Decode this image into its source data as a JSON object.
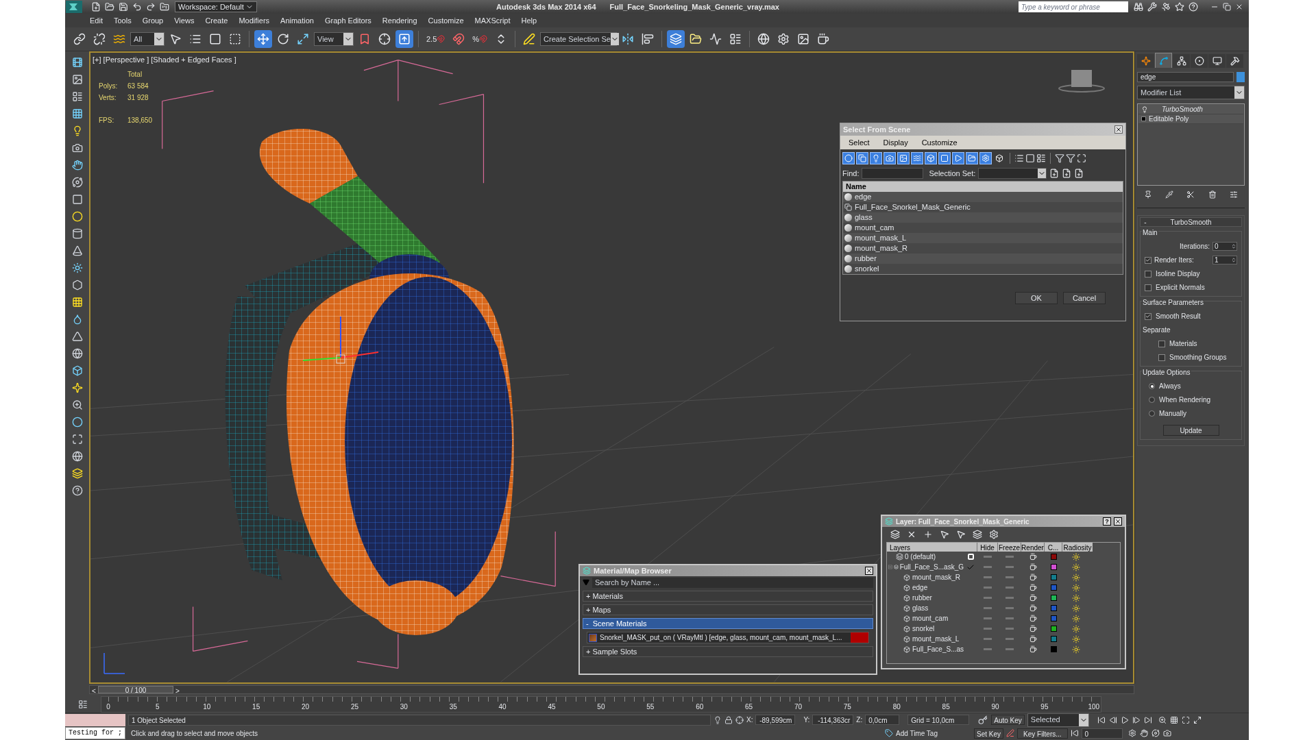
{
  "window": {
    "title": "Autodesk 3ds Max  2014 x64",
    "document": "Full_Face_Snorkeling_Mask_Generic_vray.max",
    "workspace": "Workspace: Default",
    "search": {
      "placeholder": "Type a keyword or phrase"
    }
  },
  "menu": [
    "Edit",
    "Tools",
    "Group",
    "Views",
    "Create",
    "Modifiers",
    "Animation",
    "Graph Editors",
    "Rendering",
    "Customize",
    "MAXScript",
    "Help"
  ],
  "toolbar": {
    "selection_filter": "All",
    "reference_coord": "View",
    "snap": "2.5",
    "percent_snap": "%",
    "named_selection": "Create Selection Se",
    "tools": [
      {
        "selected": false
      },
      {
        "selected": false
      },
      {
        "selected": false
      },
      {
        "selected": false
      },
      {
        "selected": false
      },
      {
        "selected": false
      },
      {
        "selected": false
      },
      {
        "selected": true
      },
      {
        "selected": false
      },
      {
        "selected": false
      },
      {
        "selected": false
      },
      {
        "selected": false
      },
      {
        "selected": true
      },
      {
        "selected": false
      },
      {
        "selected": false
      },
      {
        "selected": false
      },
      {
        "selected": false
      },
      {
        "selected": false
      },
      {
        "selected": true
      },
      {
        "selected": false
      },
      {
        "selected": false
      },
      {
        "selected": false
      },
      {
        "selected": false
      },
      {
        "selected": false
      },
      {
        "selected": false
      },
      {
        "selected": false
      }
    ]
  },
  "viewport": {
    "label": "[+] [Perspective ] [Shaded + Edged Faces ]",
    "stats": {
      "heading": "Total",
      "rows": [
        {
          "label": "Polys:",
          "value": "63 584"
        },
        {
          "label": "Verts:",
          "value": "31 928"
        }
      ],
      "fps_label": "FPS:",
      "fps": "138,650"
    }
  },
  "select_from_scene": {
    "title": "Select From Scene",
    "menu": [
      "Select",
      "Display",
      "Customize"
    ],
    "filters": [
      {
        "on": true
      },
      {
        "on": true
      },
      {
        "on": true
      },
      {
        "on": true
      },
      {
        "on": true
      },
      {
        "on": true
      },
      {
        "on": true
      },
      {
        "on": true
      },
      {
        "on": true
      },
      {
        "on": true
      },
      {
        "on": true
      },
      {
        "on": false
      }
    ],
    "find_label": "Find:",
    "selection_set_label": "Selection Set:",
    "column": "Name",
    "objects": [
      {
        "name": "edge",
        "kind": "object"
      },
      {
        "name": "Full_Face_Snorkel_Mask_Generic",
        "kind": "group"
      },
      {
        "name": "glass",
        "kind": "object"
      },
      {
        "name": "mount_cam",
        "kind": "object"
      },
      {
        "name": "mount_mask_L",
        "kind": "object"
      },
      {
        "name": "mount_mask_R",
        "kind": "object"
      },
      {
        "name": "rubber",
        "kind": "object"
      },
      {
        "name": "snorkel",
        "kind": "object"
      }
    ],
    "buttons": [
      "OK",
      "Cancel"
    ]
  },
  "command_panel": {
    "tabs": [
      {
        "selected": false
      },
      {
        "selected": true
      },
      {
        "selected": false
      },
      {
        "selected": false
      },
      {
        "selected": false
      },
      {
        "selected": false
      }
    ],
    "object_name": "edge",
    "modifier_list": "Modifier List",
    "stack": [
      {
        "name": "TurboSmooth",
        "kind": "modifier"
      },
      {
        "name": "Editable Poly",
        "kind": "base"
      }
    ],
    "rollout": {
      "sign": "-",
      "title": "TurboSmooth",
      "groups": [
        {
          "title": "Main",
          "controls": [
            {
              "kind": "spinner",
              "label": "Iterations:",
              "value": "0"
            },
            {
              "kind": "check_spinner",
              "label": "Render Iters:",
              "value": "1",
              "checked": true
            },
            {
              "kind": "check",
              "label": "Isoline Display",
              "checked": false
            },
            {
              "kind": "check",
              "label": "Explicit Normals",
              "checked": false
            }
          ]
        },
        {
          "title": "Surface Parameters",
          "controls": [
            {
              "kind": "check",
              "label": "Smooth Result",
              "checked": true
            },
            {
              "kind": "label",
              "label": "Separate"
            },
            {
              "kind": "subcheck",
              "label": "Materials",
              "checked": false
            },
            {
              "kind": "subcheck",
              "label": "Smoothing Groups",
              "checked": false
            }
          ]
        },
        {
          "title": "Update Options",
          "controls": [
            {
              "kind": "radio",
              "label": "Always",
              "selected": true
            },
            {
              "kind": "radio",
              "label": "When Rendering",
              "selected": false
            },
            {
              "kind": "radio",
              "label": "Manually",
              "selected": false
            },
            {
              "kind": "button",
              "label": "Update"
            }
          ]
        }
      ]
    }
  },
  "layer_dialog": {
    "title": "Layer: Full_Face_Snorkel_Mask_Generic",
    "help": "?",
    "columns": [
      "Layers",
      "Hide",
      "Freeze",
      "Render",
      "C...",
      "Radiosity"
    ],
    "layers": [
      {
        "name": "0 (default)",
        "current": false,
        "color": "#8a0a0a"
      },
      {
        "name": "Full_Face_S...ask_G",
        "current": true,
        "expanded": true,
        "color": "#d24fd2",
        "children": [
          {
            "name": "mount_mask_R",
            "color": "#147c8c"
          },
          {
            "name": "edge",
            "color": "#1f56c4"
          },
          {
            "name": "rubber",
            "color": "#1fb456"
          },
          {
            "name": "glass",
            "color": "#1f56c4"
          },
          {
            "name": "mount_cam",
            "color": "#1f56c4"
          },
          {
            "name": "snorkel",
            "color": "#20b020"
          },
          {
            "name": "mount_mask_L",
            "color": "#147c8c"
          },
          {
            "name": "Full_Face_S...as",
            "color": "#000000"
          }
        ]
      }
    ]
  },
  "material_browser": {
    "title": "Material/Map Browser",
    "search": {
      "placeholder": "Search by Name ..."
    },
    "groups": [
      {
        "sign": "+",
        "label": "Materials",
        "expanded": false
      },
      {
        "sign": "+",
        "label": "Maps",
        "expanded": false
      },
      {
        "sign": "-",
        "label": "Scene Materials",
        "expanded": true,
        "items": [
          "Snorkel_MASK_put_on  ( VRayMtl ) [edge, glass, mount_cam, mount_mask_L..."
        ]
      },
      {
        "sign": "+",
        "label": "Sample Slots",
        "expanded": false
      }
    ]
  },
  "timeline": {
    "prev": "<",
    "frame": "0 / 100",
    "next": ">",
    "ticks": [
      "0",
      "5",
      "10",
      "15",
      "20",
      "25",
      "30",
      "35",
      "40",
      "45",
      "50",
      "55",
      "60",
      "65",
      "70",
      "75",
      "80",
      "85",
      "90",
      "95",
      "100"
    ]
  },
  "status": {
    "listener": "Testing for ;",
    "selection": "1 Object Selected",
    "prompt": "Click and drag to select and move objects",
    "x_label": "X:",
    "x": "-89,599cm",
    "y_label": "Y:",
    "y": "-114,363cr",
    "z_label": "Z:",
    "z": "0,0cm",
    "grid": "Grid = 10,0cm",
    "auto_key": "Auto Key",
    "key_mode": "Selected",
    "set_key": "Set Key",
    "key_filters": "Key Filters...",
    "time_tag": "Add Time Tag",
    "current_frame": "0"
  }
}
